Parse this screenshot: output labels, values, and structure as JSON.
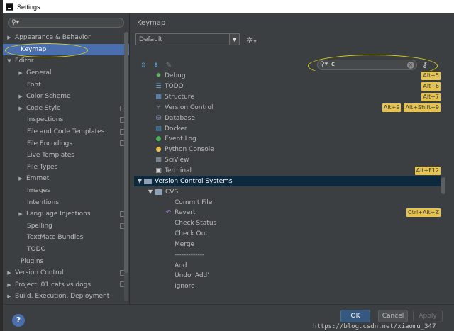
{
  "window": {
    "title": "Settings"
  },
  "left": {
    "search": {
      "value": "",
      "icon": "search-icon"
    },
    "tree": [
      {
        "label": "Appearance & Behavior",
        "level": 0,
        "arrow": "▶"
      },
      {
        "label": "Keymap",
        "level": 0,
        "selected": true
      },
      {
        "label": "Editor",
        "level": 0,
        "arrow": "▼"
      },
      {
        "label": "General",
        "level": 1,
        "arrow": "▶"
      },
      {
        "label": "Font",
        "level": 1
      },
      {
        "label": "Color Scheme",
        "level": 1,
        "arrow": "▶"
      },
      {
        "label": "Code Style",
        "level": 1,
        "arrow": "▶",
        "copy": true
      },
      {
        "label": "Inspections",
        "level": 1,
        "copy": true
      },
      {
        "label": "File and Code Templates",
        "level": 1,
        "copy": true
      },
      {
        "label": "File Encodings",
        "level": 1,
        "copy": true
      },
      {
        "label": "Live Templates",
        "level": 1
      },
      {
        "label": "File Types",
        "level": 1
      },
      {
        "label": "Emmet",
        "level": 1,
        "arrow": "▶"
      },
      {
        "label": "Images",
        "level": 1
      },
      {
        "label": "Intentions",
        "level": 1
      },
      {
        "label": "Language Injections",
        "level": 1,
        "arrow": "▶",
        "copy": true
      },
      {
        "label": "Spelling",
        "level": 1,
        "copy": true
      },
      {
        "label": "TextMate Bundles",
        "level": 1
      },
      {
        "label": "TODO",
        "level": 1
      },
      {
        "label": "Plugins",
        "level": 0
      },
      {
        "label": "Version Control",
        "level": 0,
        "arrow": "▶",
        "copy": true
      },
      {
        "label": "Project: 01 cats vs dogs",
        "level": 0,
        "arrow": "▶",
        "copy": true
      },
      {
        "label": "Build, Execution, Deployment",
        "level": 0,
        "arrow": "▶"
      }
    ]
  },
  "right": {
    "title": "Keymap",
    "keymap_select": {
      "value": "Default"
    },
    "search": {
      "value": "c",
      "icon": "search-icon"
    },
    "rows": [
      {
        "name": "Debug",
        "icon": "debug-icon",
        "keys": [
          "Alt+5"
        ]
      },
      {
        "name": "TODO",
        "icon": "todo-icon",
        "keys": [
          "Alt+6"
        ]
      },
      {
        "name": "Structure",
        "icon": "structure-icon",
        "keys": [
          "Alt+7"
        ]
      },
      {
        "name": "Version Control",
        "icon": "version-control-icon",
        "keys": [
          "Alt+9",
          "Alt+Shift+9"
        ]
      },
      {
        "name": "Database",
        "icon": "database-icon",
        "keys": []
      },
      {
        "name": "Docker",
        "icon": "docker-icon",
        "keys": []
      },
      {
        "name": "Event Log",
        "icon": "event-log-icon",
        "keys": []
      },
      {
        "name": "Python Console",
        "icon": "python-console-icon",
        "keys": []
      },
      {
        "name": "SciView",
        "icon": "sciview-icon",
        "keys": []
      },
      {
        "name": "Terminal",
        "icon": "terminal-icon",
        "keys": [
          "Alt+F12"
        ]
      },
      {
        "name": "Version Control Systems",
        "icon": "folder-icon",
        "keys": [],
        "selected": true,
        "folder": true,
        "depth": 0
      },
      {
        "name": "CVS",
        "icon": "folder-icon",
        "keys": [],
        "folder": true,
        "depth": 1
      },
      {
        "name": "Commit File",
        "keys": [],
        "depth": 2
      },
      {
        "name": "Revert",
        "icon": "revert-icon",
        "keys": [
          "Ctrl+Alt+Z"
        ],
        "depth": 2
      },
      {
        "name": "Check Status",
        "keys": [],
        "depth": 2
      },
      {
        "name": "Check Out",
        "keys": [],
        "depth": 2
      },
      {
        "name": "Merge",
        "keys": [],
        "depth": 2
      },
      {
        "name": "-------------",
        "keys": [],
        "depth": 2
      },
      {
        "name": "Add",
        "keys": [],
        "depth": 2
      },
      {
        "name": "Undo 'Add'",
        "keys": [],
        "depth": 2
      },
      {
        "name": "Ignore",
        "keys": [],
        "depth": 2
      }
    ]
  },
  "buttons": {
    "ok": "OK",
    "cancel": "Cancel",
    "apply": "Apply",
    "help": "?"
  },
  "watermark": "https://blog.csdn.net/xiaomu_347",
  "colors": {
    "selection": "#4b6eaf",
    "shortcut": "#e6c34f",
    "highlight_oval": "#d9d21a",
    "ok": "#365880"
  }
}
